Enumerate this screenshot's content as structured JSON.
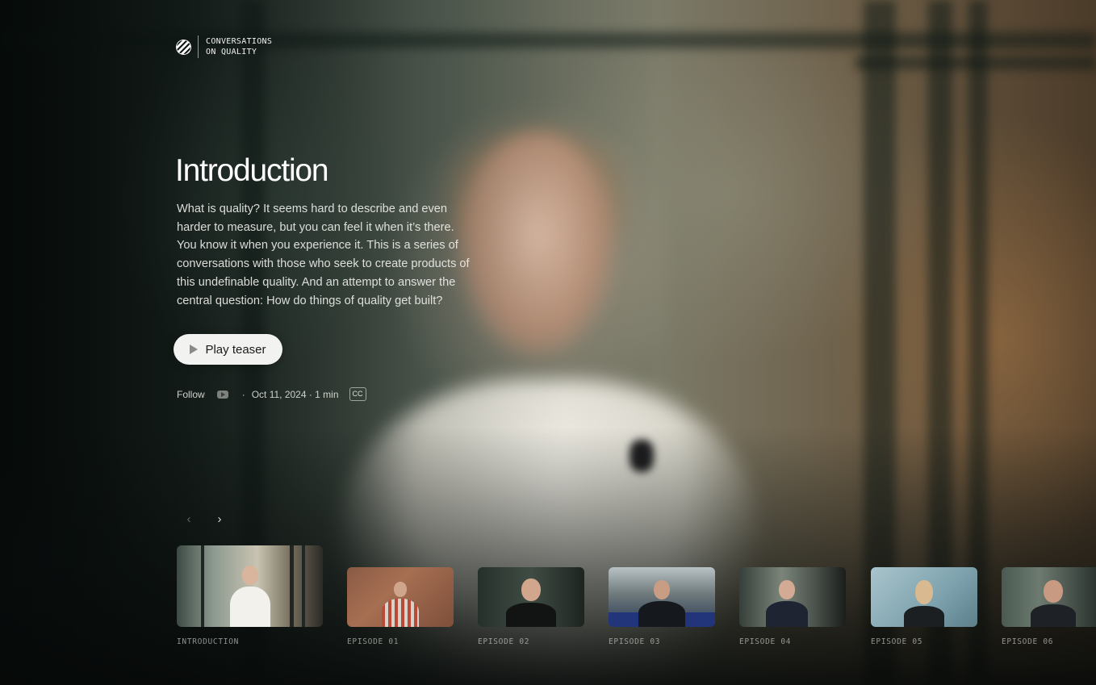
{
  "brand": {
    "line1": "CONVERSATIONS",
    "line2": "ON QUALITY"
  },
  "hero": {
    "title": "Introduction",
    "description": "What is quality? It seems hard to describe and even harder to measure, but you can feel it when it’s there. You know it when you experience it. This is a series of conversations with those who seek to create products of this undefinable quality. And an attempt to answer the central question: How do things of quality get built?",
    "play_label": "Play teaser"
  },
  "meta": {
    "follow_label": "Follow",
    "separator": "·",
    "date_duration": "Oct 11, 2024 · 1 min",
    "cc_label": "CC"
  },
  "carousel": {
    "prev_icon": "chevron-left-icon",
    "next_icon": "chevron-right-icon",
    "episodes": [
      {
        "label": "INTRODUCTION"
      },
      {
        "label": "EPISODE 01"
      },
      {
        "label": "EPISODE 02"
      },
      {
        "label": "EPISODE 03"
      },
      {
        "label": "EPISODE 04"
      },
      {
        "label": "EPISODE 05"
      },
      {
        "label": "EPISODE 06"
      }
    ]
  },
  "colors": {
    "button_bg": "#f2f2f0",
    "button_text": "#1a1a1a",
    "label_muted": "#c8c8c3"
  }
}
